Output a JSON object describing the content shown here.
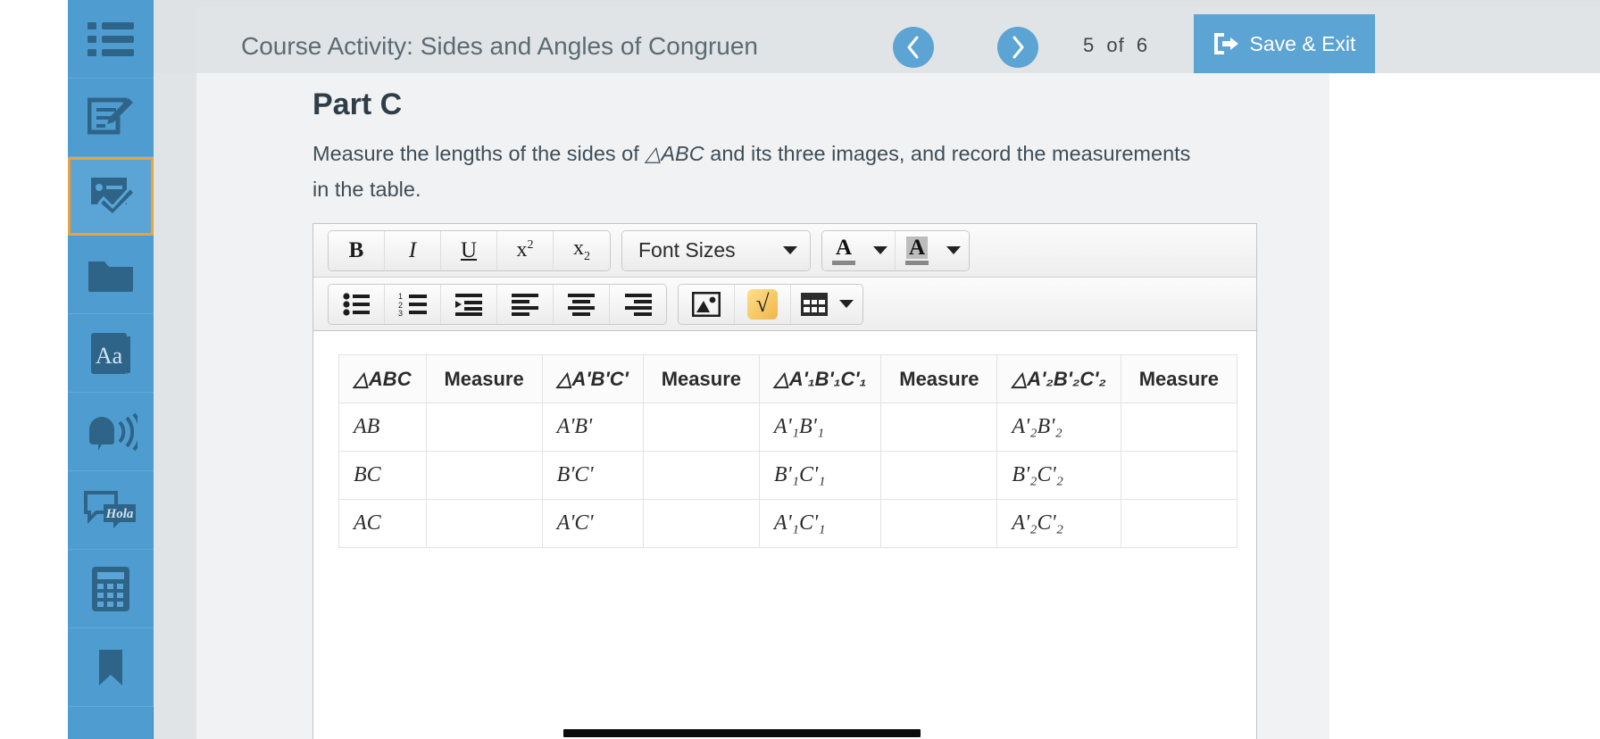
{
  "header": {
    "course_title": "Course Activity: Sides and Angles of Congruen",
    "prev_label": "Previous",
    "next_label": "Next",
    "page_current": "5",
    "page_of": "of",
    "page_total": "6",
    "save_exit_label": "Save & Exit",
    "accent_blue": "#5ba4d4",
    "bar_bg": "#e1e4e6"
  },
  "sidebar": {
    "bg": "#4f9dd0",
    "icon_color": "#2f6489",
    "active_outline": "#e8a33d",
    "items": [
      {
        "name": "table-of-contents",
        "label": "Table of Contents",
        "active": false
      },
      {
        "name": "notes",
        "label": "Notes",
        "active": false
      },
      {
        "name": "assignments",
        "label": "Assignments",
        "active": true
      },
      {
        "name": "resources",
        "label": "Resources",
        "active": false
      },
      {
        "name": "glossary",
        "label": "Glossary",
        "active": false
      },
      {
        "name": "text-to-speech",
        "label": "Text to Speech",
        "active": false
      },
      {
        "name": "translate",
        "label": "Translate",
        "active": false
      },
      {
        "name": "calculator",
        "label": "Calculator",
        "active": false
      }
    ],
    "glossary_glyph": "Aa",
    "translate_glyph": "Hola"
  },
  "main": {
    "part_heading": "Part C",
    "instruction_pre": "Measure the lengths of the sides of ",
    "instruction_tri": "△ABC",
    "instruction_post": " and its three images, and record the measurements in the table."
  },
  "editor": {
    "toolbar_row1": [
      {
        "name": "bold-button",
        "label": "B"
      },
      {
        "name": "italic-button",
        "label": "I"
      },
      {
        "name": "underline-button",
        "label": "U"
      },
      {
        "name": "superscript-button",
        "label": "x",
        "script": "2"
      },
      {
        "name": "subscript-button",
        "label": "x",
        "script": "2"
      }
    ],
    "font_sizes_label": "Font Sizes",
    "text_color_label": "A",
    "background_color_label": "A",
    "toolbar_row2": [
      {
        "name": "bullet-list-button",
        "label": "Bulleted List"
      },
      {
        "name": "numbered-list-button",
        "label": "Numbered List"
      },
      {
        "name": "indent-button",
        "label": "Increase Indent"
      },
      {
        "name": "align-left-button",
        "label": "Align Left"
      },
      {
        "name": "align-center-button",
        "label": "Align Center"
      },
      {
        "name": "align-right-button",
        "label": "Align Right"
      }
    ],
    "insert_image_label": "Insert Image",
    "equation_label": "√",
    "table_label": "Insert Table"
  },
  "table": {
    "headers": [
      "△ABC",
      "Measure",
      "△A'B'C'",
      "Measure",
      "△A'₁B'₁C'₁",
      "Measure",
      "△A'₂B'₂C'₂",
      "Measure"
    ],
    "rows": [
      {
        "c0": "AB",
        "c1": "",
        "c2": "A'B'",
        "c3": "",
        "c4": "A'₁B'₁",
        "c5": "",
        "c6": "A'₂B'₂",
        "c7": ""
      },
      {
        "c0": "BC",
        "c1": "",
        "c2": "B'C'",
        "c3": "",
        "c4": "B'₁C'₁",
        "c5": "",
        "c6": "B'₂C'₂",
        "c7": ""
      },
      {
        "c0": "AC",
        "c1": "",
        "c2": "A'C'",
        "c3": "",
        "c4": "A'₁C'₁",
        "c5": "",
        "c6": "A'₂C'₂",
        "c7": ""
      }
    ]
  }
}
